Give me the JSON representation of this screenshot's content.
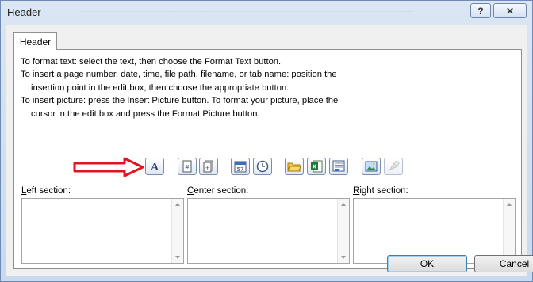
{
  "window": {
    "title": "Header",
    "help_label": "?",
    "close_label": "✕"
  },
  "tab": {
    "label": "Header"
  },
  "instructions": [
    "To format text:  select the text, then choose the Format Text button.",
    "To insert a page number, date, time, file path, filename, or tab name:  position the",
    "insertion point in the edit box, then choose the appropriate button.",
    "To insert picture: press the Insert Picture button.  To format your picture, place the",
    "cursor in the edit box and press the Format Picture button."
  ],
  "toolbar": [
    {
      "name": "format-text-button",
      "icon": "format-text-icon"
    },
    {
      "name": "insert-page-number-button",
      "icon": "page-number-icon"
    },
    {
      "name": "insert-number-of-pages-button",
      "icon": "number-of-pages-icon"
    },
    {
      "name": "insert-date-button",
      "icon": "calendar-icon"
    },
    {
      "name": "insert-time-button",
      "icon": "clock-icon"
    },
    {
      "name": "insert-file-path-button",
      "icon": "folder-icon"
    },
    {
      "name": "insert-file-name-button",
      "icon": "excel-file-icon"
    },
    {
      "name": "insert-sheet-name-button",
      "icon": "sheet-tab-icon"
    },
    {
      "name": "insert-picture-button",
      "icon": "picture-icon"
    },
    {
      "name": "format-picture-button",
      "icon": "format-picture-icon",
      "disabled": true
    }
  ],
  "sections": {
    "left": {
      "accel": "L",
      "rest": "eft section:"
    },
    "center": {
      "accel": "C",
      "rest": "enter section:"
    },
    "right": {
      "accel": "R",
      "rest": "ight section:"
    }
  },
  "buttons": {
    "ok": "OK",
    "cancel": "Cancel"
  },
  "colors": {
    "annotation_arrow": "#e0141e",
    "title_bg": "#d5e2f3"
  }
}
